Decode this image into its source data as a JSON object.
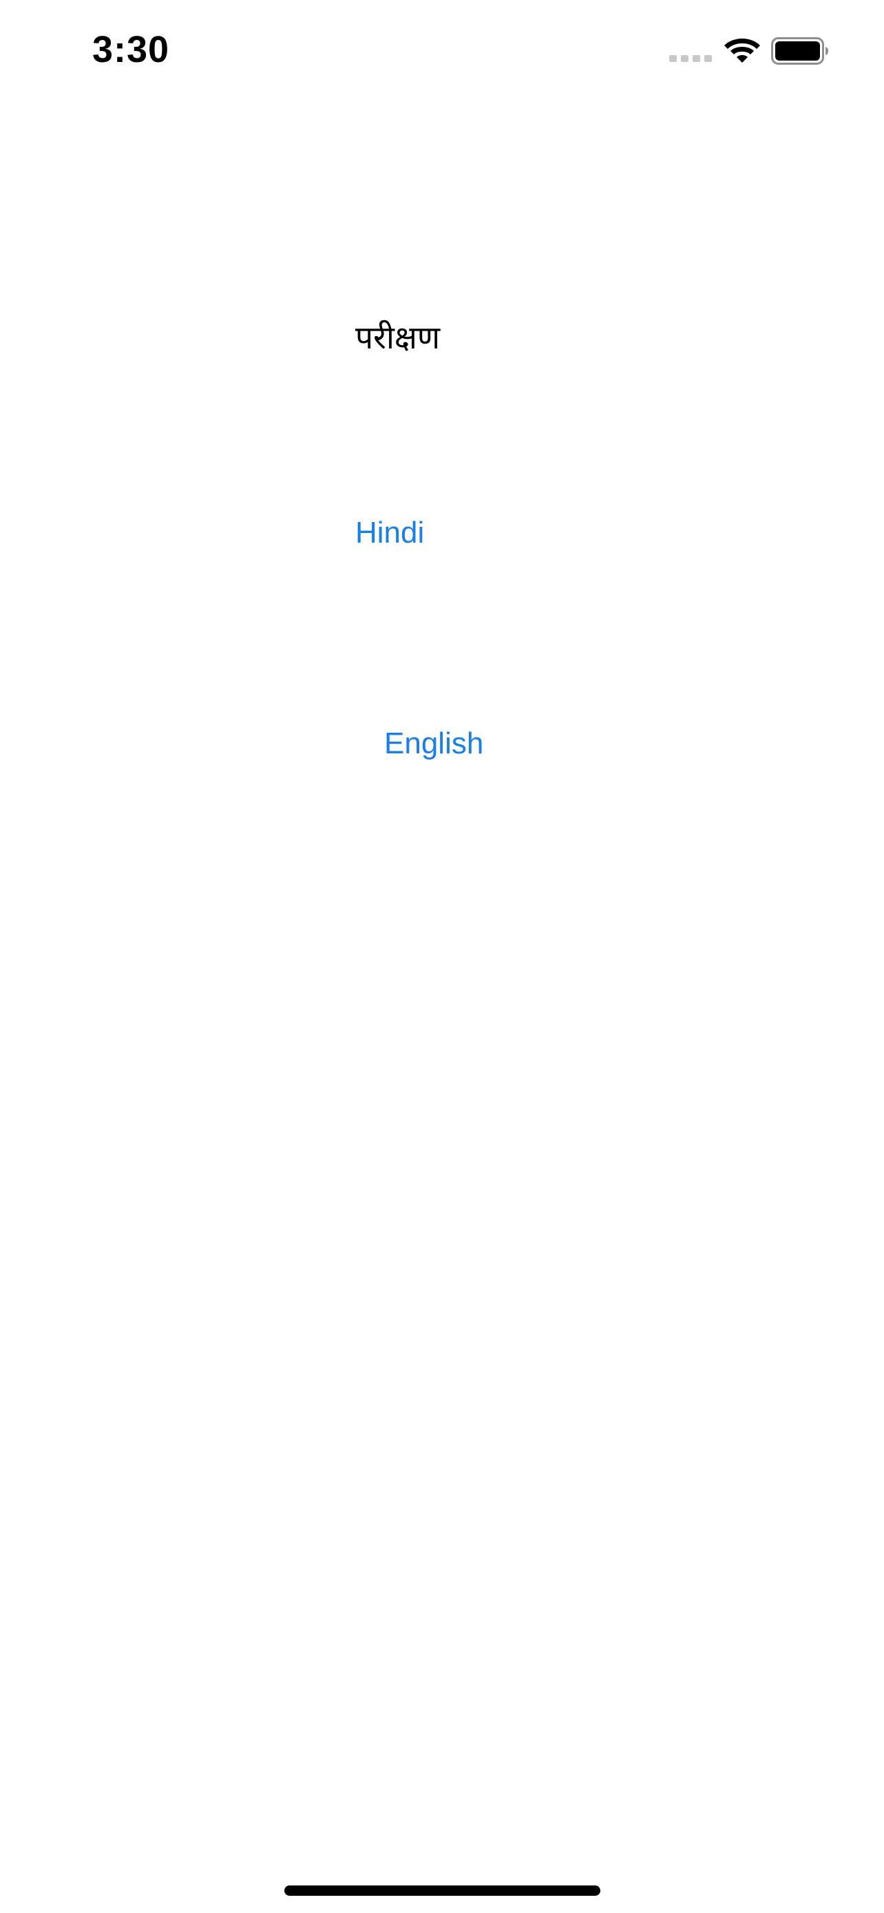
{
  "status_bar": {
    "time": "3:30",
    "signal_icon": "cellular-signal-icon",
    "wifi_icon": "wifi-icon",
    "battery_icon": "battery-icon"
  },
  "main": {
    "title": "परीक्षण",
    "buttons": [
      {
        "label": "Hindi"
      },
      {
        "label": "English"
      }
    ]
  },
  "colors": {
    "accent": "#1a7fe6",
    "text": "#000000",
    "background": "#ffffff"
  }
}
